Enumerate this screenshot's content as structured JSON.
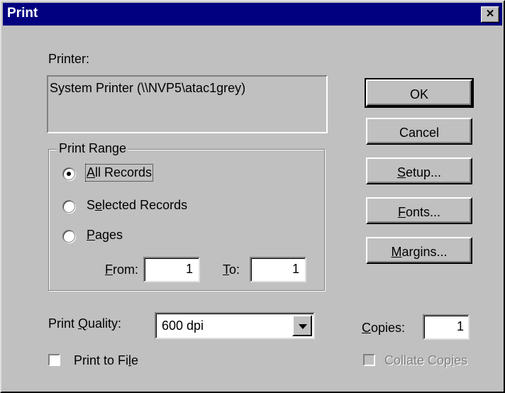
{
  "window": {
    "title": "Print",
    "close_glyph": "×"
  },
  "printer": {
    "label": "Printer:",
    "value": "System Printer (\\\\NVP5\\atac1grey)"
  },
  "print_range": {
    "title": "Print Range",
    "options": [
      {
        "pre": "",
        "u": "A",
        "post": "ll Records",
        "selected": true
      },
      {
        "pre": "S",
        "u": "e",
        "post": "lected Records",
        "selected": false
      },
      {
        "pre": "",
        "u": "P",
        "post": "ages",
        "selected": false
      }
    ],
    "from_label_u": "F",
    "from_label_rest": "rom:",
    "from_value": "1",
    "to_label_u": "T",
    "to_label_rest": "o:",
    "to_value": "1"
  },
  "buttons": {
    "ok": "OK",
    "cancel": "Cancel",
    "setup_u": "S",
    "setup_rest": "etup...",
    "fonts_u": "F",
    "fonts_rest": "onts...",
    "margins_u": "M",
    "margins_rest": "argins..."
  },
  "quality": {
    "label_pre": "Print ",
    "label_u": "Q",
    "label_post": "uality:",
    "value": "600 dpi"
  },
  "copies": {
    "label_u": "C",
    "label_rest": "opies:",
    "value": "1"
  },
  "print_to_file": {
    "pre": "Print to Fi",
    "u": "l",
    "post": "e",
    "checked": false
  },
  "collate": {
    "pre": "Collate Cop",
    "u": "i",
    "post": "es",
    "checked": false,
    "disabled": true
  }
}
